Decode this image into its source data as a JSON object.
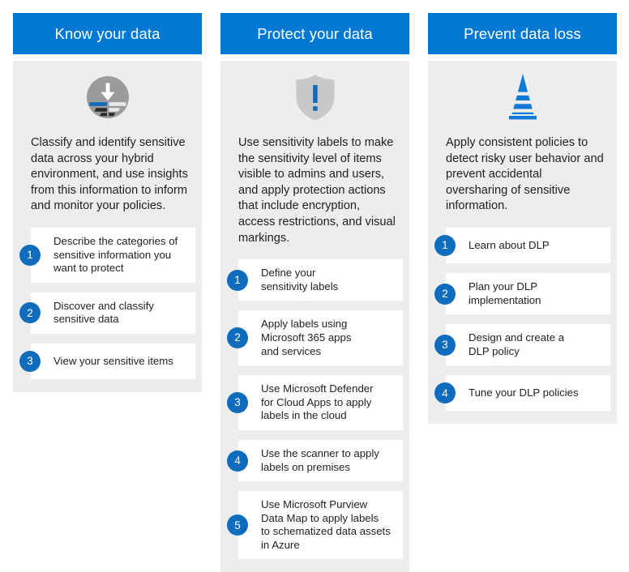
{
  "theme": {
    "header_bg": "#0078d4",
    "panel_bg": "#ededed",
    "card_bg": "#ffffff",
    "badge_bg": "#0f6cbd",
    "text_color": "#201f1e",
    "page_bg": "#ffffff"
  },
  "columns": [
    {
      "id": "know-your-data",
      "title": "Know your data",
      "icon": "classify-data-icon",
      "description": "Classify and identify sensitive data across your hybrid environment, and use insights from this information to inform and monitor your policies.",
      "steps": [
        {
          "number": "1",
          "label": "Describe the categories of\nsensitive information you\nwant to protect"
        },
        {
          "number": "2",
          "label": "Discover and classify\nsensitive data"
        },
        {
          "number": "3",
          "label": "View your sensitive items"
        }
      ]
    },
    {
      "id": "protect-your-data",
      "title": "Protect your data",
      "icon": "shield-exclamation-icon",
      "description": "Use sensitivity labels to make the sensitivity level of items visible to admins and users, and apply protection actions that include encryption, access restrictions, and visual markings.",
      "steps": [
        {
          "number": "1",
          "label": "Define your\nsensitivity labels"
        },
        {
          "number": "2",
          "label": "Apply labels using\nMicrosoft 365 apps\nand services"
        },
        {
          "number": "3",
          "label": "Use Microsoft Defender\nfor Cloud Apps to apply\nlabels in the cloud"
        },
        {
          "number": "4",
          "label": "Use the scanner to apply\nlabels on premises"
        },
        {
          "number": "5",
          "label": "Use Microsoft Purview\nData Map to apply labels\nto schematized data assets\nin Azure"
        }
      ]
    },
    {
      "id": "prevent-data-loss",
      "title": "Prevent data loss",
      "icon": "traffic-cone-icon",
      "description": "Apply consistent policies to detect risky user behavior and prevent accidental oversharing of sensitive information.",
      "steps": [
        {
          "number": "1",
          "label": "Learn about DLP"
        },
        {
          "number": "2",
          "label": "Plan your DLP\nimplementation"
        },
        {
          "number": "3",
          "label": "Design and create a\nDLP policy"
        },
        {
          "number": "4",
          "label": "Tune your DLP policies"
        }
      ]
    }
  ]
}
